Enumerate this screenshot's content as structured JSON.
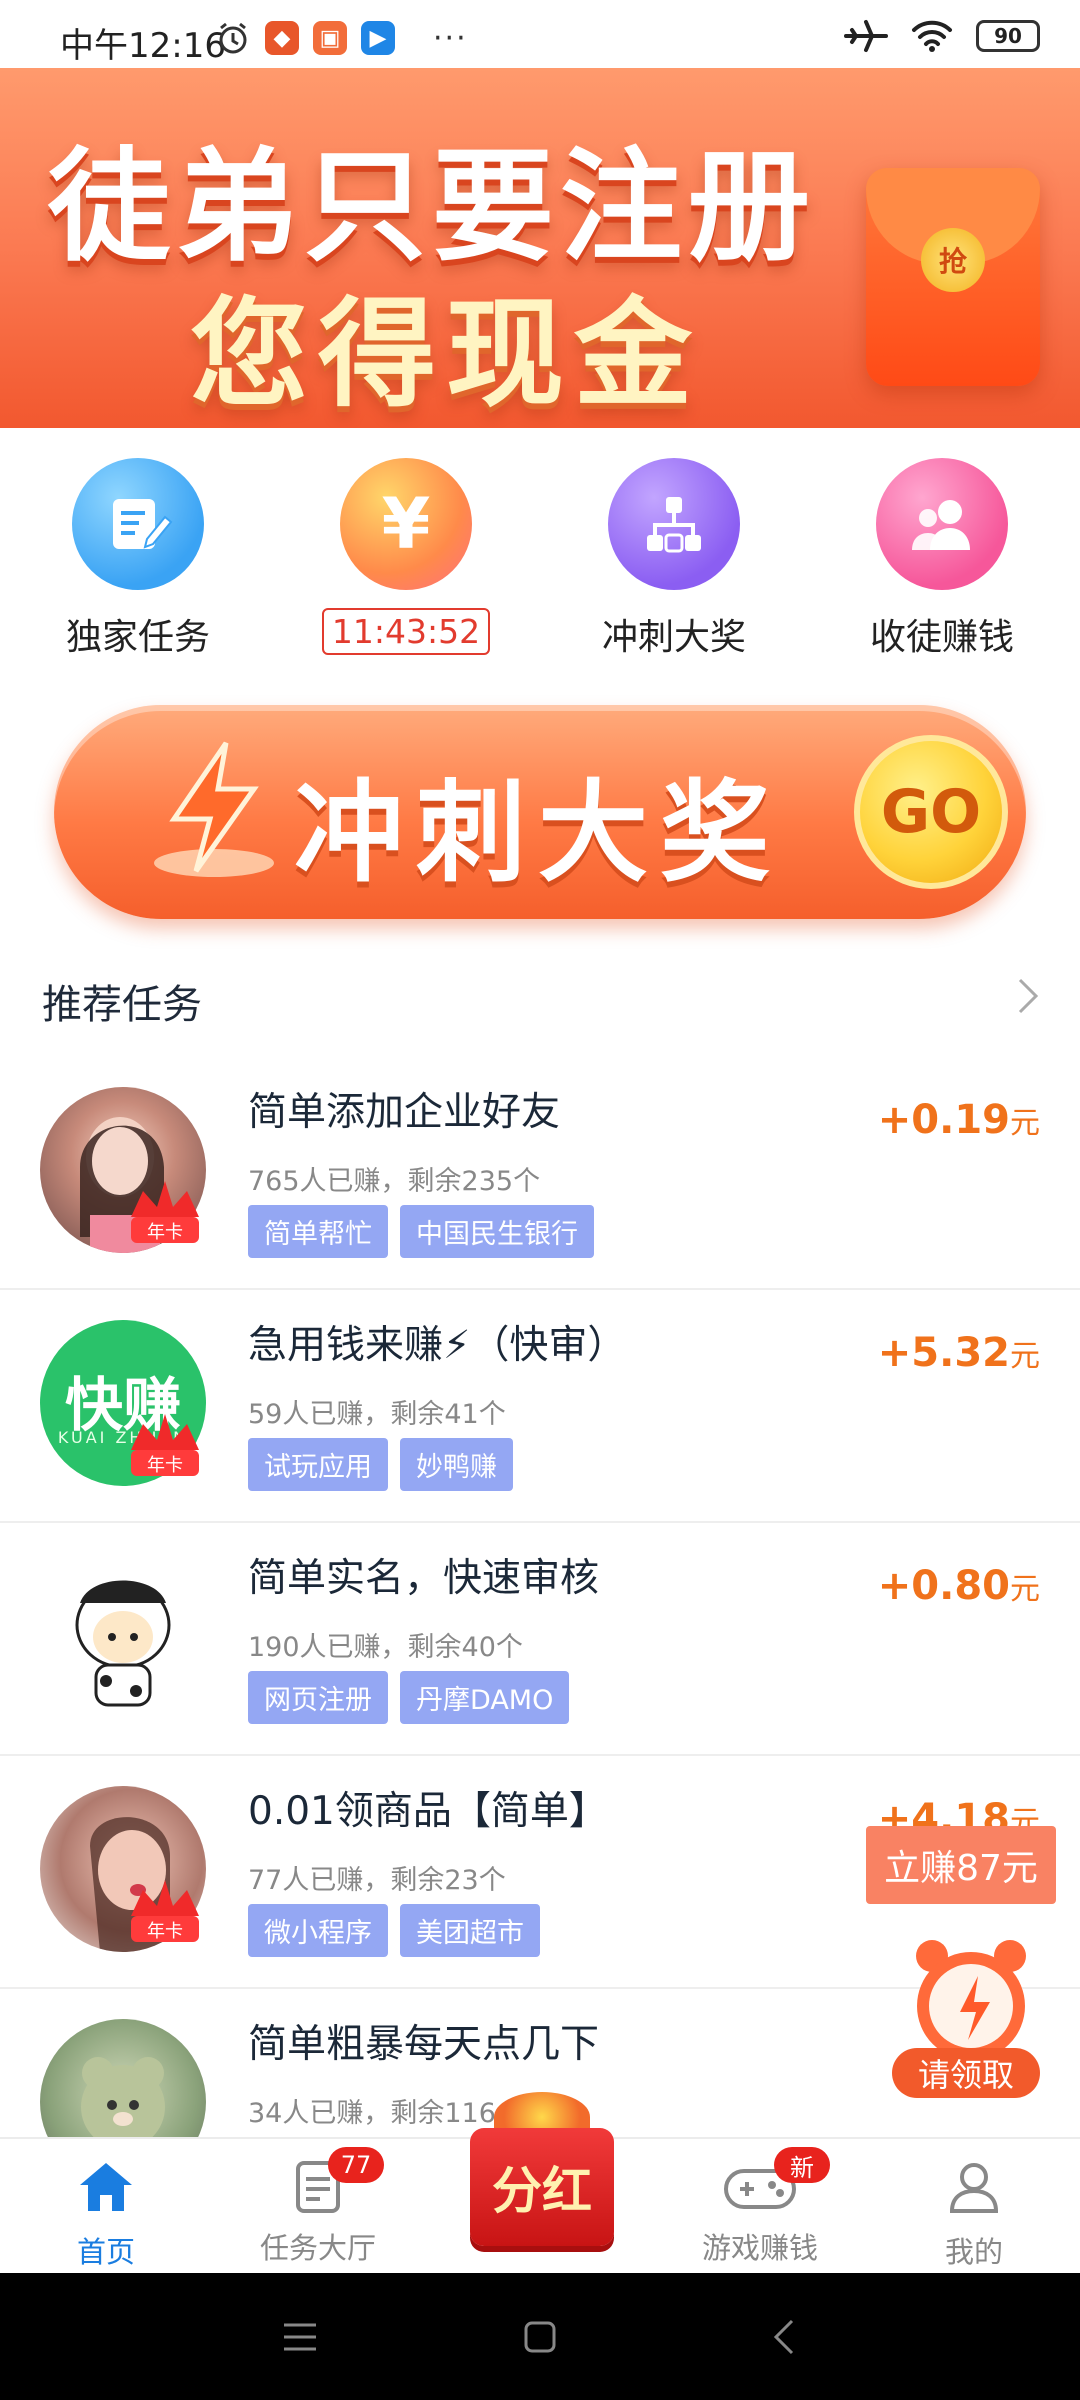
{
  "status_bar": {
    "time": "中午12:16",
    "more": "···",
    "battery": "90"
  },
  "banner": {
    "line1": "徒弟只要注册",
    "line2": "您得现金",
    "packet_text": "抢"
  },
  "quick_nav": [
    {
      "label": "独家任务",
      "icon": "edit-note-icon"
    },
    {
      "label": "11:43:52",
      "icon": "yuan-icon"
    },
    {
      "label": "冲刺大奖",
      "icon": "network-icon"
    },
    {
      "label": "收徒赚钱",
      "icon": "users-icon"
    }
  ],
  "sprint_banner": {
    "text": "冲刺大奖",
    "go": "GO"
  },
  "section": {
    "title": "推荐任务"
  },
  "tasks": [
    {
      "title": "简单添加企业好友",
      "sub": "765人已赚，剩余235个",
      "tags": [
        "简单帮忙",
        "中国民生银行"
      ],
      "reward": "+0.19",
      "unit": "元",
      "crown": "年卡"
    },
    {
      "title": "急用钱来赚⚡（快审）",
      "sub": "59人已赚，剩余41个",
      "tags": [
        "试玩应用",
        "妙鸭赚"
      ],
      "reward": "+5.32",
      "unit": "元",
      "crown": "年卡",
      "logo_text": "快赚",
      "logo_sub": "KUAI ZHUAN"
    },
    {
      "title": "简单实名，快速审核",
      "sub": "190人已赚，剩余40个",
      "tags": [
        "网页注册",
        "丹摩DAMO"
      ],
      "reward": "+0.80",
      "unit": "元"
    },
    {
      "title": "0.01领商品【简单】",
      "sub": "77人已赚，剩余23个",
      "tags": [
        "微小程序",
        "美团超市"
      ],
      "reward": "+4.18",
      "unit": "元",
      "crown": "年卡"
    },
    {
      "title": "简单粗暴每天点几下",
      "sub": "34人已赚，剩余116个",
      "tags": [],
      "reward": "",
      "unit": ""
    }
  ],
  "floating": {
    "earn": "立赚87元",
    "claim": "请领取"
  },
  "tabbar": [
    {
      "label": "首页",
      "icon": "home-icon",
      "active": true
    },
    {
      "label": "任务大厅",
      "icon": "task-list-icon",
      "badge": "77"
    },
    {
      "label": "分红",
      "icon": "red-packet-icon"
    },
    {
      "label": "游戏赚钱",
      "icon": "gamepad-icon",
      "badge": "新"
    },
    {
      "label": "我的",
      "icon": "profile-icon"
    }
  ],
  "colors": {
    "accent_blue": "#1a7de0",
    "reward_orange": "#f0721b",
    "tag_bg": "#94a7f3",
    "banner_orange": "#fb7a52"
  }
}
